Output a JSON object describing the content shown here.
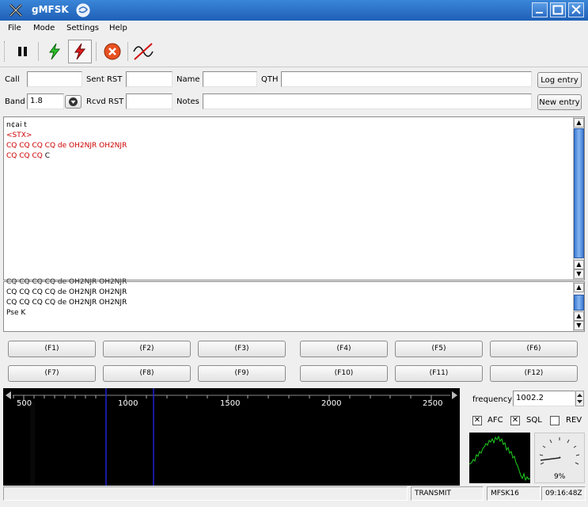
{
  "window": {
    "title": "gMFSK"
  },
  "menu": {
    "file": "File",
    "mode": "Mode",
    "settings": "Settings",
    "help": "Help"
  },
  "log": {
    "call_label": "Call",
    "call_value": "",
    "sent_rst_label": "Sent RST",
    "sent_rst_value": "",
    "name_label": "Name",
    "name_value": "",
    "qth_label": "QTH",
    "qth_value": "",
    "log_entry_button": "Log entry",
    "band_label": "Band",
    "band_value": "1.8",
    "rcvd_rst_label": "Rcvd RST",
    "rcvd_rst_value": "",
    "notes_label": "Notes",
    "notes_value": "",
    "new_entry_button": "New entry"
  },
  "rx_text": {
    "lines": [
      {
        "text": "n¢ai t",
        "color": "#000000"
      },
      {
        "text": "<STX>",
        "color": "#cc0000"
      },
      {
        "text": "CQ CQ CQ CQ de OH2NJR OH2NJR",
        "color": "#cc0000"
      }
    ],
    "last_line_red": "CQ CQ CQ ",
    "last_line_black": "C"
  },
  "tx_text": {
    "lines": [
      "CQ CQ CQ CQ de OH2NJR OH2NJR",
      "CQ CQ CQ CQ de OH2NJR OH2NJR",
      "Pse K"
    ]
  },
  "macros": {
    "row1": [
      "(F1)",
      "(F2)",
      "(F3)",
      "(F4)",
      "(F5)",
      "(F6)"
    ],
    "row2": [
      "(F7)",
      "(F8)",
      "(F9)",
      "(F10)",
      "(F11)",
      "(F12)"
    ]
  },
  "waterfall": {
    "scale_labels": [
      "500",
      "1000",
      "1500",
      "2000",
      "2500"
    ]
  },
  "controls": {
    "frequency_label": "frequency",
    "frequency_value": "1002.2",
    "afc_label": "AFC",
    "afc_checked": true,
    "sql_label": "SQL",
    "sql_checked": true,
    "rev_label": "REV",
    "rev_checked": false,
    "squelch_meter": "9%"
  },
  "status": {
    "mode": "TRANSMIT",
    "modem": "MFSK16",
    "time": "09:16:48Z"
  },
  "colors": {
    "titlebar": "#2a72c8",
    "rx_red": "#cc0000",
    "scroll_thumb": "#3b7bd6",
    "waterfall_line": "#2020d0"
  }
}
